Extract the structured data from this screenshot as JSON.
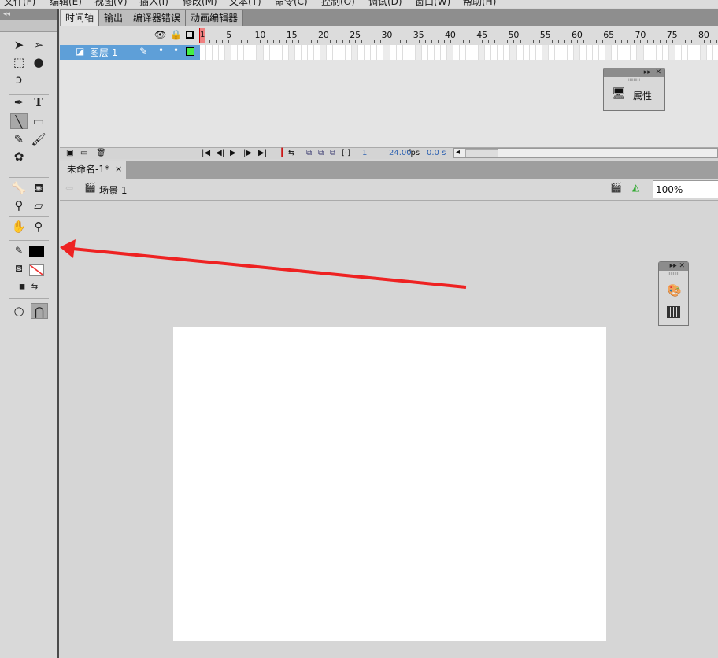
{
  "menu": [
    "文件(F)",
    "编辑(E)",
    "视图(V)",
    "插入(I)",
    "修改(M)",
    "文本(T)",
    "命令(C)",
    "控制(O)",
    "调试(D)",
    "窗口(W)",
    "帮助(H)"
  ],
  "toolbar": {
    "collapse": "◂◂"
  },
  "timeline": {
    "tabs": [
      "时间轴",
      "输出",
      "编译器错误",
      "动画编辑器"
    ],
    "ruler": [
      1,
      5,
      10,
      15,
      20,
      25,
      30,
      35,
      40,
      45,
      50,
      55,
      60,
      65,
      70,
      75,
      80
    ],
    "layer_name": "图层 1",
    "current_frame": "1",
    "fps": "24.00",
    "fps_unit": "fps",
    "time": "0.0 s",
    "playhead": "1"
  },
  "document": {
    "tab": "未命名-1*",
    "close": "×",
    "scene": "场景 1",
    "zoom": "100%"
  },
  "panels": {
    "properties": "属性"
  },
  "colors": {
    "stroke": "#000000",
    "fill": "none",
    "layer_color": "#44ee44",
    "arrow": "#ee2222"
  }
}
